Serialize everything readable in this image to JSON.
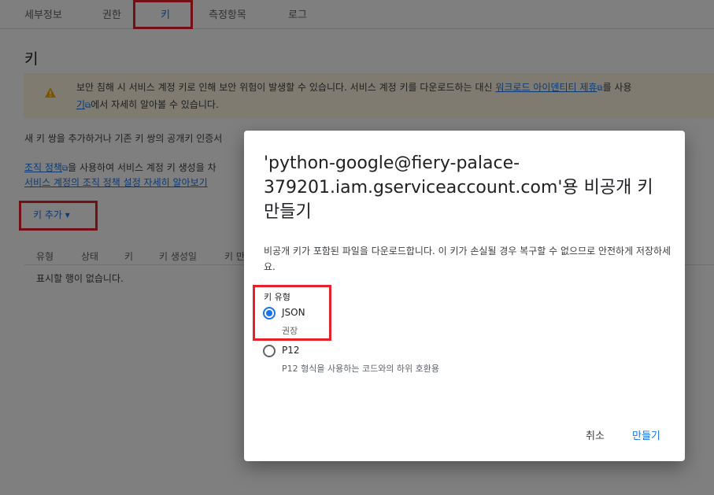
{
  "tabs": [
    {
      "label": "세부정보"
    },
    {
      "label": "권한"
    },
    {
      "label": "키"
    },
    {
      "label": "측정항목"
    },
    {
      "label": "로그"
    }
  ],
  "page_title": "키",
  "warning": {
    "text_1": "보안 침해 시 서비스 계정 키로 인해 보안 위험이 발생할 수 있습니다. 서비스 계정 키를 다운로드하는 대신 ",
    "link_1": "워크로드 아이덴티티 제휴",
    "text_2": "를 사용",
    "link_2": "기",
    "text_3": "에서 자세히 알아볼 수 있습니다."
  },
  "body": {
    "line_1": "새 키 쌍을 추가하거나 기존 키 쌍의 공개키 인증서",
    "policy_link": "조직 정책",
    "policy_text": "을 사용하여 서비스 계정 키 생성을 차",
    "learn_link": "서비스 계정의 조직 정책 설정 자세히 알아보기"
  },
  "add_key_label": "키 추가 ▾",
  "table": {
    "headers": [
      "유형",
      "상태",
      "키",
      "키 생성일",
      "키 만"
    ],
    "empty_text": "표시할 행이 없습니다."
  },
  "dialog": {
    "title": "'python-google@fiery-palace-379201.iam.gserviceaccount.com'용 비공개 키 만들기",
    "description": "비공개 키가 포함된 파일을 다운로드합니다. 이 키가 손실될 경우 복구할 수 없으므로 안전하게 저장하세요.",
    "key_type_label": "키 유형",
    "options": [
      {
        "label": "JSON",
        "sub": "권장",
        "checked": true
      },
      {
        "label": "P12",
        "sub": "P12 형식을 사용하는 코드와의 하위 호환용",
        "checked": false
      }
    ],
    "cancel_label": "취소",
    "create_label": "만들기"
  },
  "colors": {
    "accent": "#1a73e8",
    "highlight_red": "#e8202a",
    "warning_bg": "#fef7e0",
    "warning_icon": "#f9ab00"
  }
}
